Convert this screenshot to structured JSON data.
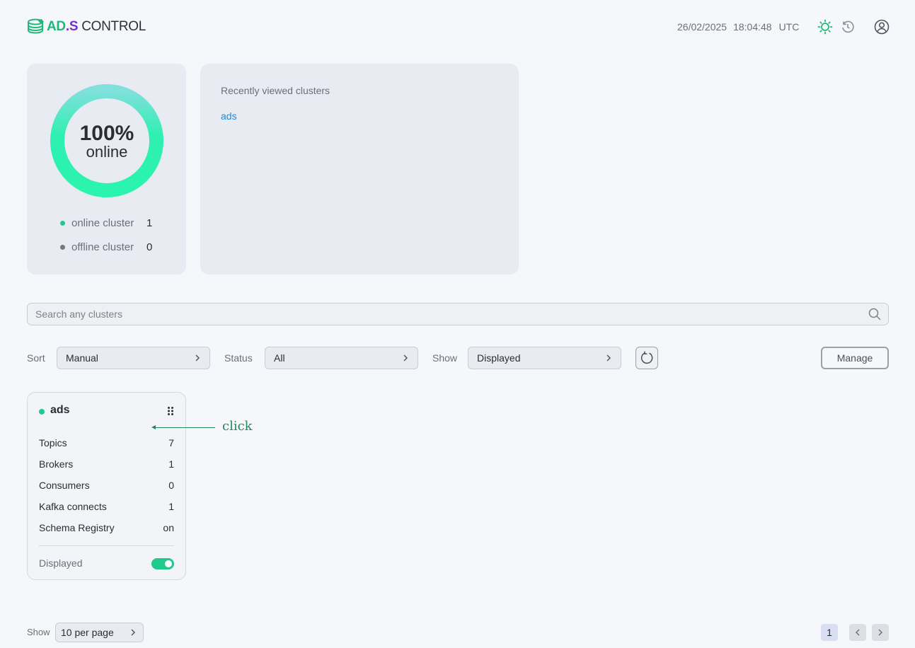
{
  "header": {
    "brand_ad": "AD",
    "brand_dot_s": ".S",
    "brand_control": "CONTROL",
    "date": "26/02/2025",
    "time": "18:04:48",
    "timezone": "UTC",
    "icons": [
      "sun-icon",
      "history-icon",
      "user-icon"
    ]
  },
  "summary": {
    "percent": "100%",
    "status_label": "online",
    "online_fraction": 1.0,
    "legend": [
      {
        "label": "online cluster",
        "value": "1",
        "color": "#20c98c"
      },
      {
        "label": "offline cluster",
        "value": "0",
        "color": "#75797f"
      }
    ]
  },
  "recent": {
    "title": "Recently viewed clusters",
    "items": [
      "ads"
    ]
  },
  "search": {
    "placeholder": "Search any clusters"
  },
  "filters": {
    "sort_label": "Sort",
    "sort_value": "Manual",
    "status_label": "Status",
    "status_value": "All",
    "show_label": "Show",
    "show_value": "Displayed",
    "manage_label": "Manage"
  },
  "cluster": {
    "name": "ads",
    "status_color": "#20c98c",
    "rows": [
      {
        "label": "Topics",
        "value": "7"
      },
      {
        "label": "Brokers",
        "value": "1"
      },
      {
        "label": "Consumers",
        "value": "0"
      },
      {
        "label": "Kafka connects",
        "value": "1"
      },
      {
        "label": "Schema Registry",
        "value": "on"
      }
    ],
    "displayed_label": "Displayed",
    "displayed_on": true
  },
  "annotation": {
    "text": "click"
  },
  "footer": {
    "per_page_label": "Show",
    "per_page_value": "10 per page",
    "current_page": "1"
  },
  "colors": {
    "accent": "#20c98c",
    "link": "#1f8ad6",
    "brand_purple": "#7a2fd0"
  }
}
